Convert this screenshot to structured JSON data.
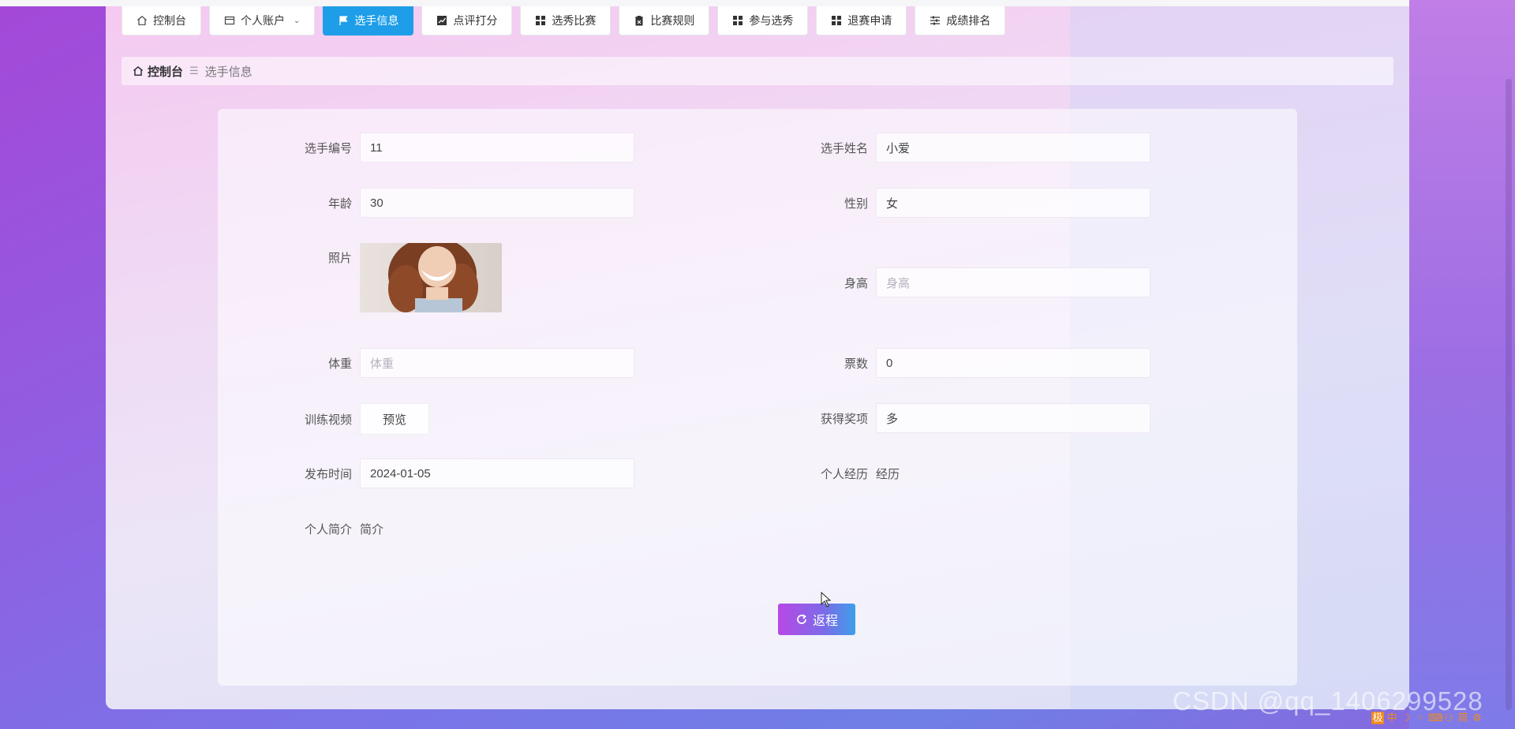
{
  "nav": {
    "tabs": [
      {
        "label": "控制台",
        "icon": "home-icon"
      },
      {
        "label": "个人账户",
        "icon": "wallet-icon",
        "has_dropdown": true
      },
      {
        "label": "选手信息",
        "icon": "flag-icon",
        "active": true
      },
      {
        "label": "点评打分",
        "icon": "chart-icon"
      },
      {
        "label": "选秀比赛",
        "icon": "grid-icon"
      },
      {
        "label": "比赛规则",
        "icon": "clipboard-icon"
      },
      {
        "label": "参与选秀",
        "icon": "grid-icon"
      },
      {
        "label": "退赛申请",
        "icon": "grid-icon"
      },
      {
        "label": "成绩排名",
        "icon": "sliders-icon"
      }
    ]
  },
  "breadcrumb": {
    "home": "控制台",
    "separator": "☰",
    "current": "选手信息"
  },
  "form": {
    "player_no": {
      "label": "选手编号",
      "value": "11"
    },
    "player_name": {
      "label": "选手姓名",
      "value": "小爱"
    },
    "age": {
      "label": "年龄",
      "value": "30"
    },
    "gender": {
      "label": "性别",
      "value": "女"
    },
    "photo": {
      "label": "照片"
    },
    "height": {
      "label": "身高",
      "placeholder": "身高"
    },
    "weight": {
      "label": "体重",
      "placeholder": "体重"
    },
    "votes": {
      "label": "票数",
      "value": "0"
    },
    "training_video": {
      "label": "训练视频",
      "button": "预览"
    },
    "awards": {
      "label": "获得奖项",
      "value": "多"
    },
    "publish_time": {
      "label": "发布时间",
      "value": "2024-01-05"
    },
    "experience": {
      "label": "个人经历",
      "value": "经历"
    },
    "intro": {
      "label": "个人简介",
      "value": "简介"
    }
  },
  "back_button": {
    "label": "返程",
    "icon": "refresh-icon"
  },
  "watermark": "CSDN @qq_1406299528",
  "ime_toolbar": [
    "极",
    "中",
    "☽",
    "⁘",
    "⌨",
    "⚇",
    "简",
    "⚙"
  ],
  "colors": {
    "active_tab": "#1e9ee8",
    "back_gradient_start": "#b848e6",
    "back_gradient_end": "#3f9fea"
  }
}
